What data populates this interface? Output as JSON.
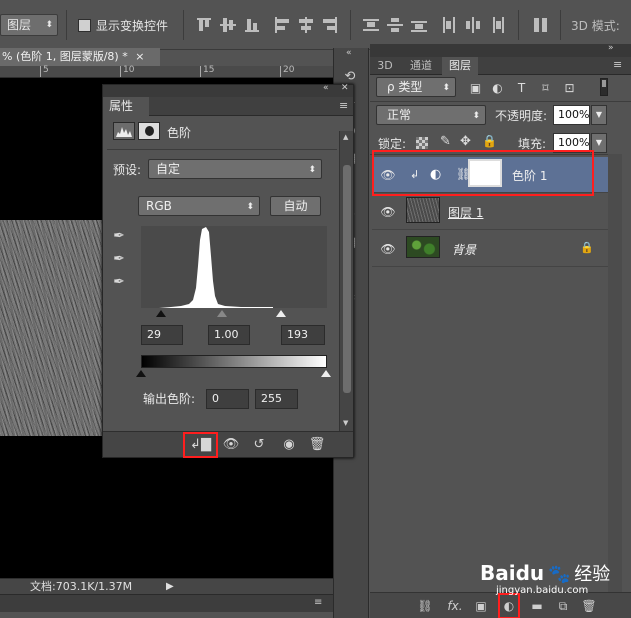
{
  "topbar": {
    "layer_dropdown": "图层",
    "show_transform_label": "显示变换控件",
    "mode_label": "3D 模式:"
  },
  "document": {
    "tab_title": "% (色阶 1, 图层蒙版/8) *",
    "tab_close": "×",
    "ruler_ticks": [
      "5",
      "10",
      "15",
      "20"
    ],
    "status_text": "文档:703.1K/1.37M"
  },
  "properties": {
    "panel_title": "属性",
    "adjust_name": "色阶",
    "preset_label": "预设:",
    "preset_value": "自定",
    "channel_value": "RGB",
    "auto_button": "自动",
    "input_black": "29",
    "input_gamma": "1.00",
    "input_white": "193",
    "output_label": "输出色阶:",
    "output_black": "0",
    "output_white": "255"
  },
  "layers_panel": {
    "tabs": [
      "3D",
      "通道",
      "图层"
    ],
    "active_tab": "图层",
    "filter_kind": "ρ 类型",
    "blend_mode": "正常",
    "opacity_label": "不透明度:",
    "opacity_value": "100%",
    "lock_label": "锁定:",
    "fill_label": "填充:",
    "fill_value": "100%",
    "layers": [
      {
        "name": "色阶 1",
        "selected": true
      },
      {
        "name": "图层 1",
        "selected": false
      },
      {
        "name": "背景",
        "selected": false
      }
    ],
    "footer_fx": "fx."
  },
  "watermark": {
    "brand": "Baidu",
    "brand_cn": "经验",
    "url": "jingyan.baidu.com"
  },
  "colors": {
    "panel_bg": "#535353",
    "selected_layer": "#5d7195",
    "highlight_red": "#ff1e1e"
  }
}
